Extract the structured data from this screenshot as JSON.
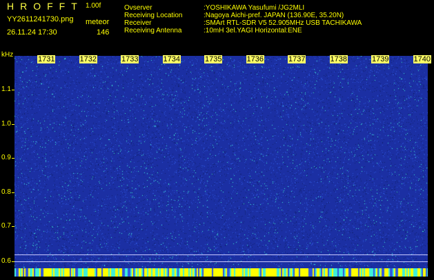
{
  "header": {
    "app_title": "HROFFT",
    "version": "1.00f",
    "filename": "YY2611241730.png",
    "meteor_label": "meteor",
    "timestamp": "26.11.24 17:30",
    "meteor_count": "146"
  },
  "info": [
    {
      "key": "Ovserver",
      "value": ":YOSHIKAWA Yasufumi /JG2MLI"
    },
    {
      "key": "Receiving Location",
      "value": ":Nagoya Aichi-pref. JAPAN (136.90E, 35.20N)"
    },
    {
      "key": "Receiver",
      "value": ":SMArt RTL-SDR V5 52.905MHz USB TACHIKAWA"
    },
    {
      "key": "Receiving Antenna",
      "value": ":10mH 3el.YAGI Horizontal:ENE"
    }
  ],
  "chart_data": {
    "type": "heatmap",
    "ylabel": "kHz",
    "y_ticks": [
      "1.1",
      "1.0",
      "0.9",
      "0.8",
      "0.7",
      "0.6"
    ],
    "x_ticks": [
      "1731",
      "1732",
      "1733",
      "1734",
      "1735",
      "1736",
      "1737",
      "1738",
      "1739",
      "1740"
    ],
    "colors": {
      "background": "#1b2fa3",
      "noise": "#2f58e0",
      "bright": "#3ff0d8"
    }
  }
}
